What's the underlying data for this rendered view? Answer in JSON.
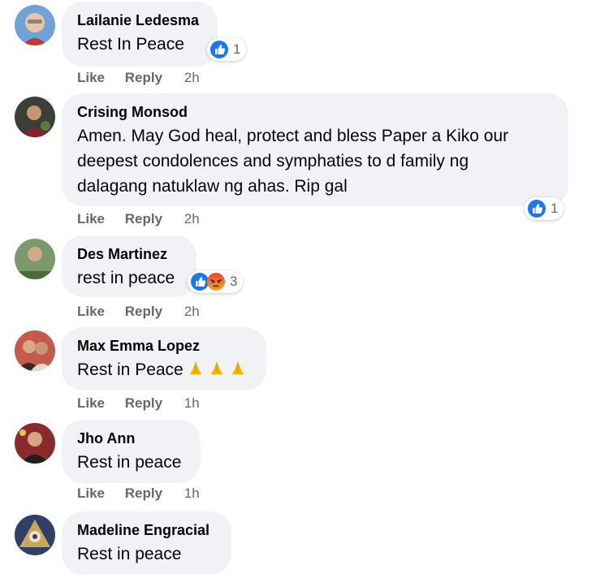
{
  "comments": [
    {
      "author": "Lailanie Ledesma",
      "lines": [
        "Rest In Peace"
      ],
      "reaction_count": "1",
      "like": "Like",
      "reply": "Reply",
      "time": "2h"
    },
    {
      "author": "Crising Monsod",
      "lines": [
        "Amen. May God heal, protect and bless Paper a Kiko our",
        "deepest condolences and symphaties to d family ng",
        "dalagang natuklaw ng ahas. Rip gal"
      ],
      "reaction_count": "1",
      "like": "Like",
      "reply": "Reply",
      "time": "2h"
    },
    {
      "author": "Des Martinez",
      "lines": [
        "rest in peace"
      ],
      "reaction_count": "3",
      "like": "Like",
      "reply": "Reply",
      "time": "2h"
    },
    {
      "author": "Max Emma Lopez",
      "lines": [
        "Rest in Peace"
      ],
      "like": "Like",
      "reply": "Reply",
      "time": "1h"
    },
    {
      "author": "Jho Ann",
      "lines": [
        "Rest in peace"
      ],
      "like": "Like",
      "reply": "Reply",
      "time": "1h"
    },
    {
      "author": "Madeline Engracial",
      "lines": [
        "Rest in peace"
      ]
    }
  ],
  "icons": {
    "like_reaction": "like-icon",
    "angry_reaction": "angry-icon",
    "pray_emoji": "folded-hands-icon"
  },
  "colors": {
    "bubble": "#f0f2f5",
    "author": "#050505",
    "meta": "#65676b",
    "like_blue": "#1877f2",
    "angry_orange": "#e9710f"
  }
}
